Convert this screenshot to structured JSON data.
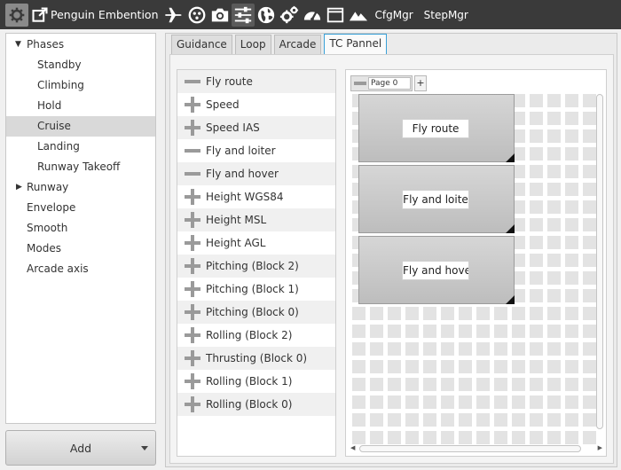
{
  "toolbar": {
    "title": "Penguin Embention",
    "cfg_label": "CfgMgr",
    "step_label": "StepMgr",
    "icons": [
      "settings-gear-icon",
      "external-link-icon",
      "airplane-icon",
      "waypoint-circle-icon",
      "camera-icon",
      "sliders-icon",
      "globe-icon",
      "gears-icon",
      "gauge-icon",
      "window-icon",
      "mountains-icon"
    ],
    "active_icon": "sliders-icon"
  },
  "tree": {
    "items": [
      {
        "label": "Phases",
        "level": 0,
        "arrow": "expanded"
      },
      {
        "label": "Standby",
        "level": 1
      },
      {
        "label": "Climbing",
        "level": 1
      },
      {
        "label": "Hold",
        "level": 1
      },
      {
        "label": "Cruise",
        "level": 1,
        "selected": true
      },
      {
        "label": "Landing",
        "level": 1
      },
      {
        "label": "Runway Takeoff",
        "level": 1
      },
      {
        "label": "Runway",
        "level": 0,
        "arrow": "collapsed"
      },
      {
        "label": "Envelope",
        "level": 0
      },
      {
        "label": "Smooth",
        "level": 0
      },
      {
        "label": "Modes",
        "level": 0
      },
      {
        "label": "Arcade axis",
        "level": 0
      }
    ]
  },
  "add_button": {
    "label": "Add"
  },
  "tabs": [
    {
      "label": "Guidance"
    },
    {
      "label": "Loop"
    },
    {
      "label": "Arcade"
    },
    {
      "label": "TC Pannel",
      "active": true
    }
  ],
  "commands": [
    {
      "label": "Fly route",
      "glyph": "minus"
    },
    {
      "label": "Speed",
      "glyph": "plus"
    },
    {
      "label": "Speed IAS",
      "glyph": "plus"
    },
    {
      "label": "Fly and loiter",
      "glyph": "minus"
    },
    {
      "label": "Fly and hover",
      "glyph": "minus"
    },
    {
      "label": "Height WGS84",
      "glyph": "plus"
    },
    {
      "label": "Height MSL",
      "glyph": "plus"
    },
    {
      "label": "Height AGL",
      "glyph": "plus"
    },
    {
      "label": "Pitching (Block 2)",
      "glyph": "plus"
    },
    {
      "label": "Pitching (Block 1)",
      "glyph": "plus"
    },
    {
      "label": "Pitching (Block 0)",
      "glyph": "plus"
    },
    {
      "label": "Rolling (Block 2)",
      "glyph": "plus"
    },
    {
      "label": "Thrusting (Block 0)",
      "glyph": "plus"
    },
    {
      "label": "Rolling (Block 1)",
      "glyph": "plus"
    },
    {
      "label": "Rolling (Block 0)",
      "glyph": "plus"
    }
  ],
  "page": {
    "name": "Page 0",
    "add_label": "+"
  },
  "widgets": [
    {
      "label": "Fly route"
    },
    {
      "label": "Fly and loite"
    },
    {
      "label": "Fly and hove"
    }
  ]
}
